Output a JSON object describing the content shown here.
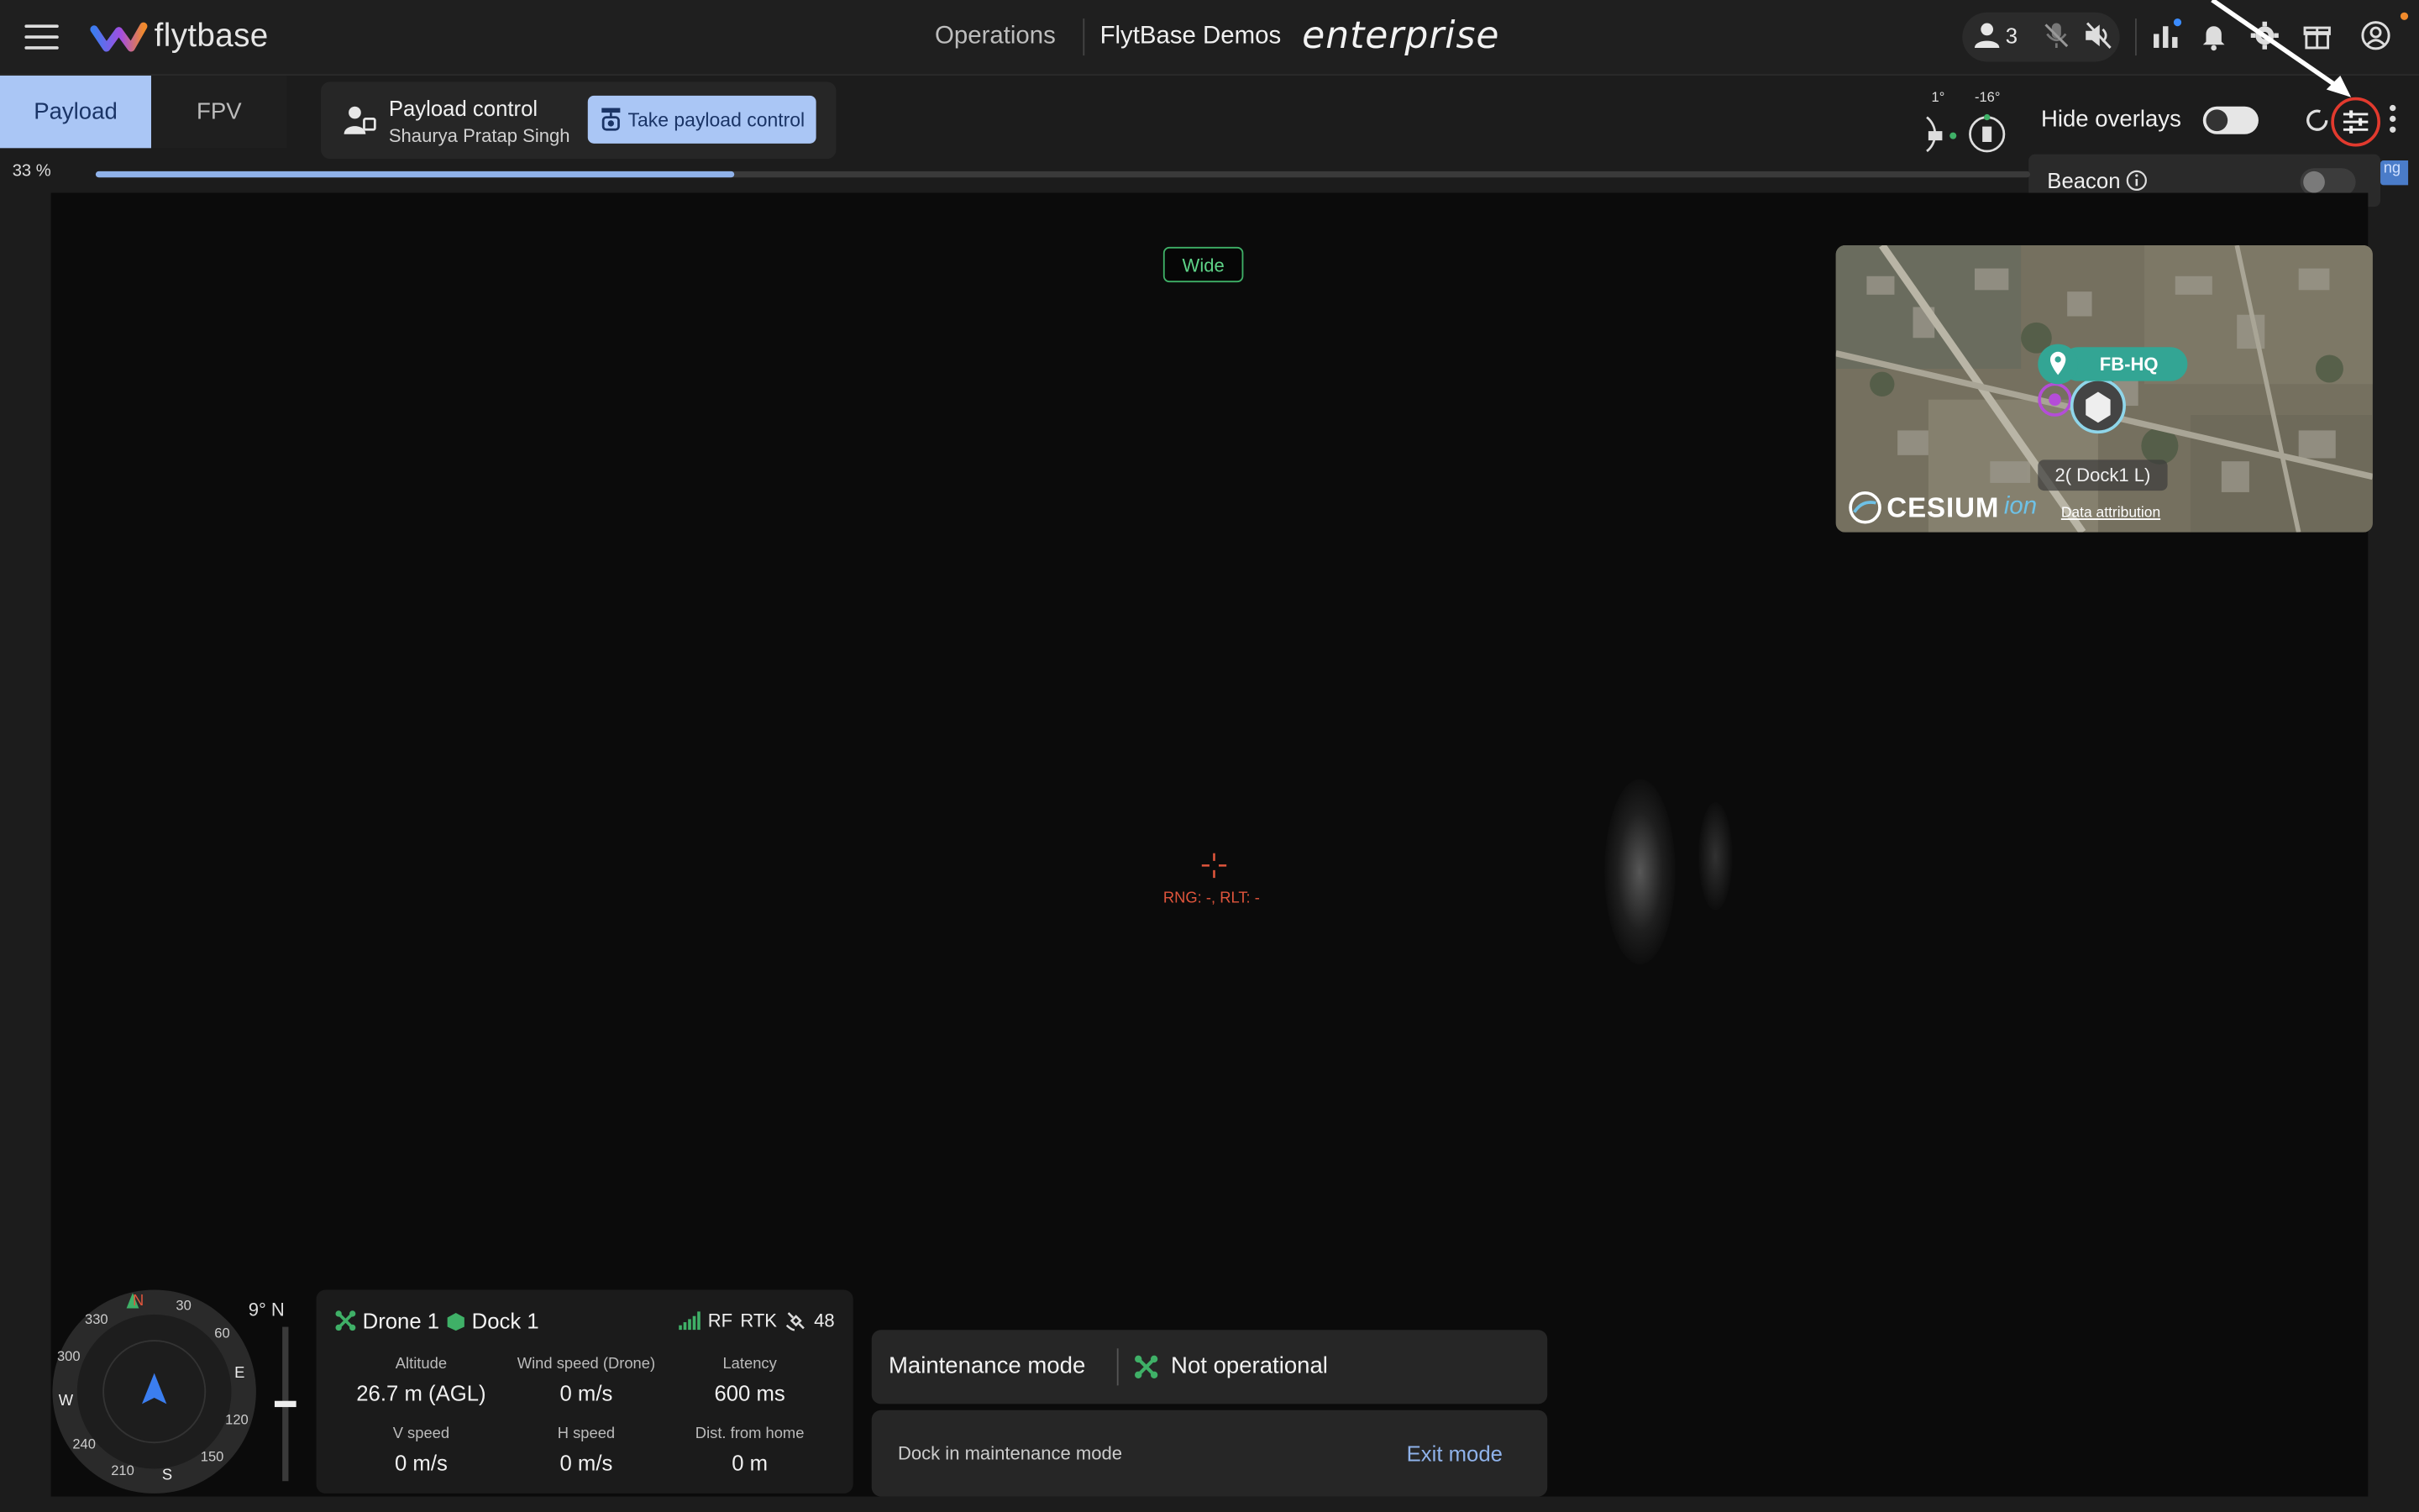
{
  "header": {
    "logo_text": "flytbase",
    "nav_operations": "Operations",
    "org_name": "FlytBase Demos",
    "edition": "enterprise",
    "users_count": "3"
  },
  "tabs": [
    {
      "label": "Payload",
      "active": true
    },
    {
      "label": "FPV",
      "active": false
    }
  ],
  "payload_control": {
    "title": "Payload control",
    "user": "Shaurya Pratap Singh",
    "take_button": "Take payload control"
  },
  "gimbal": {
    "pitch": "1°",
    "yaw": "-16°"
  },
  "overlays": {
    "hide_label": "Hide overlays",
    "hide_on": false
  },
  "beacon": {
    "label": "Beacon",
    "enabled": false
  },
  "blue_tag_text": "ng",
  "progress": {
    "label": "33 %",
    "fraction": 0.33
  },
  "video": {
    "lens_button": "Wide",
    "range_text": "RNG: -, RLT: -"
  },
  "minimap": {
    "site_label": "FB-HQ",
    "dock_label": "2( Dock1  L)",
    "provider": "CESIUM",
    "provider_suffix": "ion",
    "attribution": "Data attribution"
  },
  "compass": {
    "heading": "9° N",
    "n": "N",
    "e": "E",
    "s": "S",
    "w": "W",
    "t30": "30",
    "t60": "60",
    "t120": "120",
    "t150": "150",
    "t210": "210",
    "t240": "240",
    "t300": "300",
    "t330": "330",
    "altitude_slider_fraction": 0.5
  },
  "telemetry": {
    "drone": "Drone 1",
    "dock": "Dock 1",
    "rf": "RF",
    "rtk": "RTK",
    "satellites": "48",
    "cells": [
      {
        "key": "Altitude",
        "value": "26.7 m (AGL)"
      },
      {
        "key": "Wind speed (Drone)",
        "value": "0 m/s"
      },
      {
        "key": "Latency",
        "value": "600 ms"
      },
      {
        "key": "V speed",
        "value": "0 m/s"
      },
      {
        "key": "H speed",
        "value": "0 m/s"
      },
      {
        "key": "Dist. from home",
        "value": "0 m"
      }
    ]
  },
  "maintenance": {
    "title": "Maintenance mode",
    "status": "Not operational",
    "description": "Dock in maintenance mode",
    "exit_label": "Exit mode"
  },
  "colors": {
    "accent": "#aac6f5",
    "accent_text": "#1a3466",
    "highlight_ring": "#e23a2e",
    "ok_green": "#3fb067",
    "link": "#8fb2ea"
  }
}
